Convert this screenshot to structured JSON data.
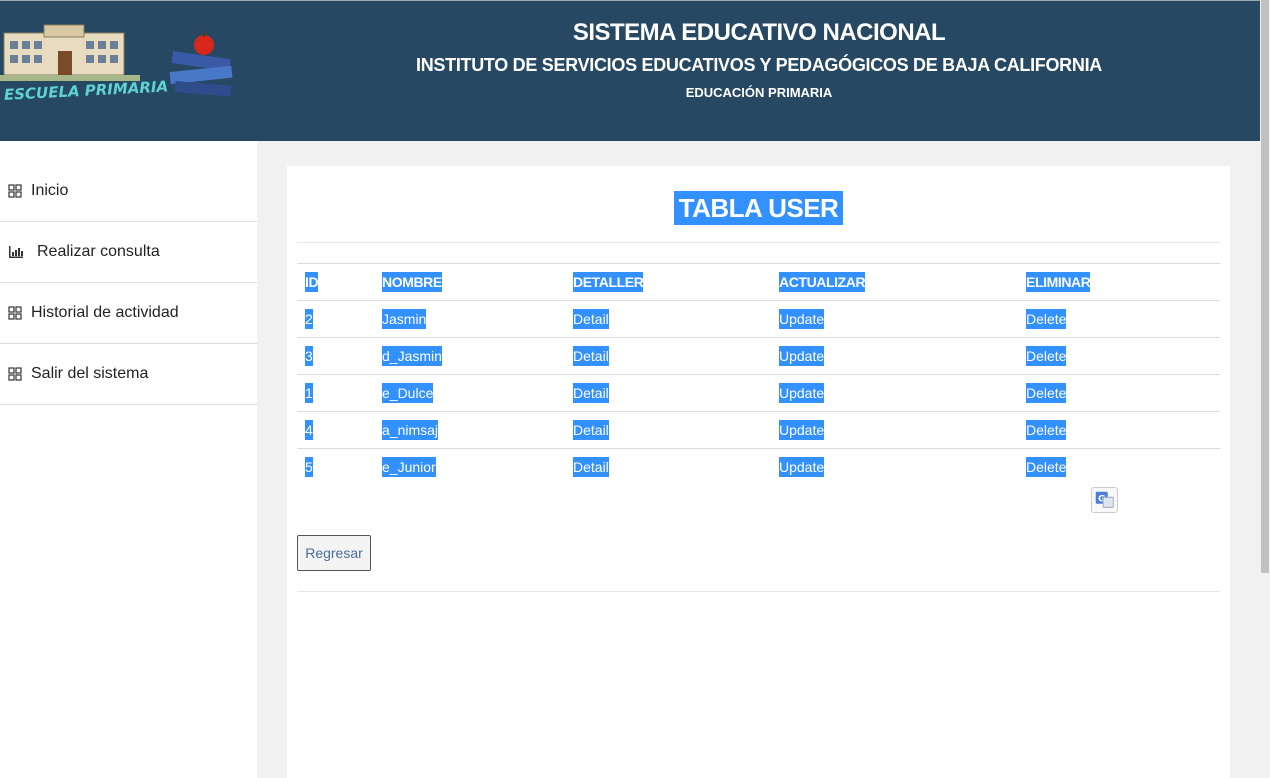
{
  "header": {
    "logo_text": "ESCUELA PRIMARIA",
    "title": "SISTEMA EDUCATIVO NACIONAL",
    "subtitle": "INSTITUTO DE SERVICIOS EDUCATIVOS Y PEDAGÓGICOS DE BAJA CALIFORNIA",
    "level": "EDUCACIÓN PRIMARIA"
  },
  "sidebar": {
    "items": [
      {
        "label": "Inicio",
        "icon": "grid-icon"
      },
      {
        "label": "Realizar consulta",
        "icon": "bar-chart-icon"
      },
      {
        "label": "Historial de actividad",
        "icon": "grid-icon"
      },
      {
        "label": "Salir del sistema",
        "icon": "grid-icon"
      }
    ]
  },
  "main": {
    "title": "TABLA USER",
    "columns": [
      "ID",
      "NOMBRE",
      "DETALLER",
      "ACTUALIZAR",
      "ELIMINAR"
    ],
    "rows": [
      {
        "id": "2",
        "nombre": "Jasmin",
        "detail": "Detail",
        "update": "Update",
        "delete": "Delete"
      },
      {
        "id": "3",
        "nombre": "d_Jasmin",
        "detail": "Detail",
        "update": "Update",
        "delete": "Delete"
      },
      {
        "id": "1",
        "nombre": "e_Dulce",
        "detail": "Detail",
        "update": "Update",
        "delete": "Delete"
      },
      {
        "id": "4",
        "nombre": "a_nimsaj",
        "detail": "Detail",
        "update": "Update",
        "delete": "Delete"
      },
      {
        "id": "5",
        "nombre": "e_Junior",
        "detail": "Detail",
        "update": "Update",
        "delete": "Delete"
      }
    ],
    "back_label": "Regresar"
  },
  "colors": {
    "header_bg": "#274862",
    "selection": "#3390ff"
  }
}
